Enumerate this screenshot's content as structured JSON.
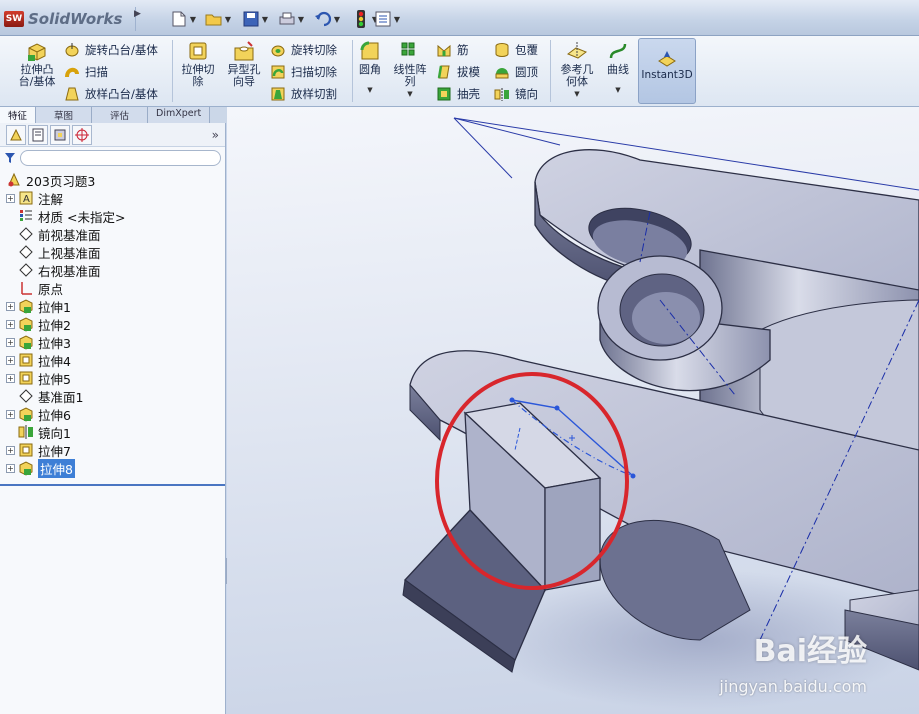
{
  "app": {
    "name": "SolidWorks",
    "logo_letters": "SW"
  },
  "quick_access": [
    {
      "icon": "new-document-icon"
    },
    {
      "icon": "open-folder-icon"
    },
    {
      "icon": "save-icon"
    },
    {
      "icon": "print-icon"
    },
    {
      "icon": "undo-icon"
    },
    {
      "icon": "rebuild-icon"
    },
    {
      "icon": "options-icon"
    }
  ],
  "ribbon": {
    "extrude_boss": "拉伸凸\n台/基体",
    "revolve_boss": "旋转凸台/基体",
    "sweep": "扫描",
    "loft_boss": "放样凸台/基体",
    "extrude_cut": "拉伸切\n除",
    "hole_wizard": "异型孔\n向导",
    "revolve_cut": "旋转切除",
    "swept_cut": "扫描切除",
    "lofted_cut": "放样切割",
    "fillet": "圆角",
    "linear_pattern": "线性阵\n列",
    "rib": "筋",
    "draft": "拔模",
    "shell": "抽壳",
    "wrap": "包覆",
    "dome": "圆顶",
    "mirror": "镜向",
    "reference_geometry": "参考几\n何体",
    "curves": "曲线",
    "instant3d": "Instant3D"
  },
  "tabs": [
    {
      "label": "特征",
      "active": true
    },
    {
      "label": "草图",
      "active": false
    },
    {
      "label": "评估",
      "active": false
    },
    {
      "label": "DimXpert",
      "active": false
    }
  ],
  "tree": {
    "root": "203页习题3",
    "items": [
      {
        "label": "注解",
        "icon": "annotations-icon",
        "expandable": true
      },
      {
        "label": "材质 <未指定>",
        "icon": "material-icon",
        "expandable": false
      },
      {
        "label": "前视基准面",
        "icon": "plane-icon",
        "expandable": false
      },
      {
        "label": "上视基准面",
        "icon": "plane-icon",
        "expandable": false
      },
      {
        "label": "右视基准面",
        "icon": "plane-icon",
        "expandable": false
      },
      {
        "label": "原点",
        "icon": "origin-icon",
        "expandable": false
      },
      {
        "label": "拉伸1",
        "icon": "extrude-feature-icon",
        "expandable": true
      },
      {
        "label": "拉伸2",
        "icon": "extrude-feature-icon",
        "expandable": true
      },
      {
        "label": "拉伸3",
        "icon": "extrude-feature-icon",
        "expandable": true
      },
      {
        "label": "拉伸4",
        "icon": "cut-feature-icon",
        "expandable": true
      },
      {
        "label": "拉伸5",
        "icon": "cut-feature-icon",
        "expandable": true
      },
      {
        "label": "基准面1",
        "icon": "plane-icon",
        "expandable": false
      },
      {
        "label": "拉伸6",
        "icon": "extrude-feature-icon",
        "expandable": true
      },
      {
        "label": "镜向1",
        "icon": "mirror-feature-icon",
        "expandable": false
      },
      {
        "label": "拉伸7",
        "icon": "cut-feature-icon",
        "expandable": true
      },
      {
        "label": "拉伸8",
        "icon": "extrude-feature-icon",
        "expandable": true,
        "selected": true
      }
    ]
  },
  "watermark": {
    "brand": "Bai经验",
    "url": "jingyan.baidu.com"
  },
  "colors": {
    "selection": "#3e7fd6",
    "highlight_circle": "#d8262c",
    "sketch_line": "#2b57d9",
    "model_face": "#9ea4be"
  }
}
